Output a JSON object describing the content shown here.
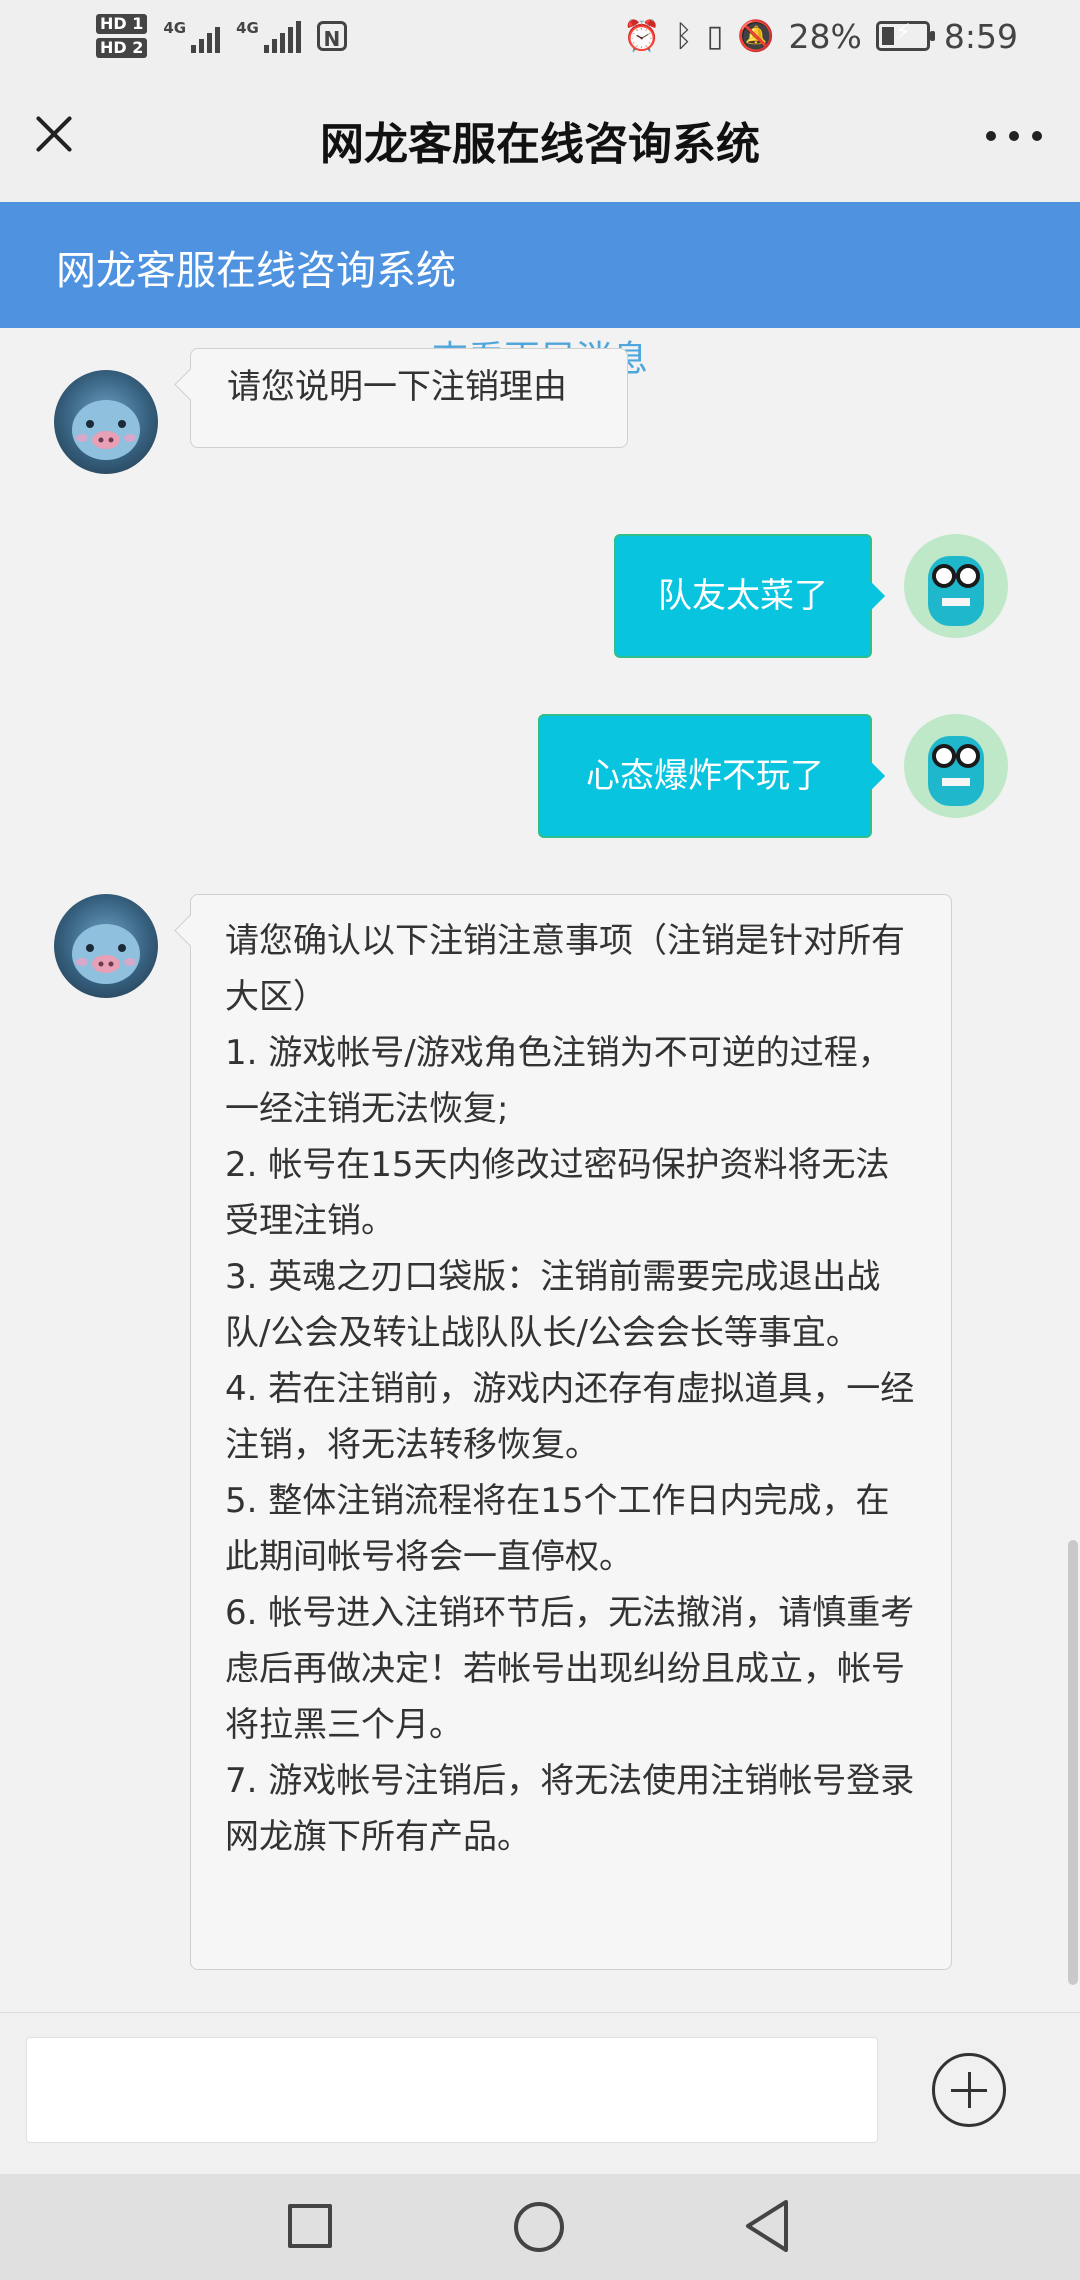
{
  "status_bar": {
    "sim1": "HD 1",
    "sim2": "HD 2",
    "network1": "4G",
    "network2": "4G",
    "nfc": "N",
    "battery": "28%",
    "battery_level": 0.28,
    "time": "8:59",
    "icons": [
      "alarm-icon",
      "bluetooth-icon",
      "vibrate-icon",
      "mute-icon",
      "battery-icon"
    ]
  },
  "title_bar": {
    "title": "网龙客服在线咨询系统",
    "close_icon": "close-icon",
    "more_icon": "more-icon"
  },
  "header": {
    "title": "网龙客服在线咨询系统",
    "color": "#4f93e0"
  },
  "chat": {
    "load_more": "查看更早消息",
    "messages": [
      {
        "sender": "agent",
        "text": "请您说明一下注销理由"
      },
      {
        "sender": "user",
        "text": "队友太菜了"
      },
      {
        "sender": "user",
        "text": "心态爆炸不玩了"
      },
      {
        "sender": "agent",
        "lines": [
          "请您确认以下注销注意事项（注销是针对所有大区）",
          "1. 游戏帐号/游戏角色注销为不可逆的过程，一经注销无法恢复;",
          "2. 帐号在15天内修改过密码保护资料将无法受理注销。",
          "3. 英魂之刃口袋版：注销前需要完成退出战队/公会及转让战队队长/公会会长等事宜。",
          "4. 若在注销前，游戏内还存有虚拟道具，一经注销，将无法转移恢复。",
          "5. 整体注销流程将在15个工作日内完成，在此期间帐号将会一直停权。",
          "6. 帐号进入注销环节后，无法撤消，请慎重考虑后再做决定！若帐号出现纠纷且成立，帐号将拉黑三个月。",
          "7. 游戏帐号注销后，将无法使用注销帐号登录网龙旗下所有产品。"
        ]
      }
    ],
    "user_bubble_color": "#08c4de"
  },
  "input_bar": {
    "value": "",
    "placeholder": "",
    "plus_icon": "plus-circle-icon"
  },
  "nav_bar": {
    "icons": [
      "recent-apps-icon",
      "home-icon",
      "back-icon"
    ]
  }
}
